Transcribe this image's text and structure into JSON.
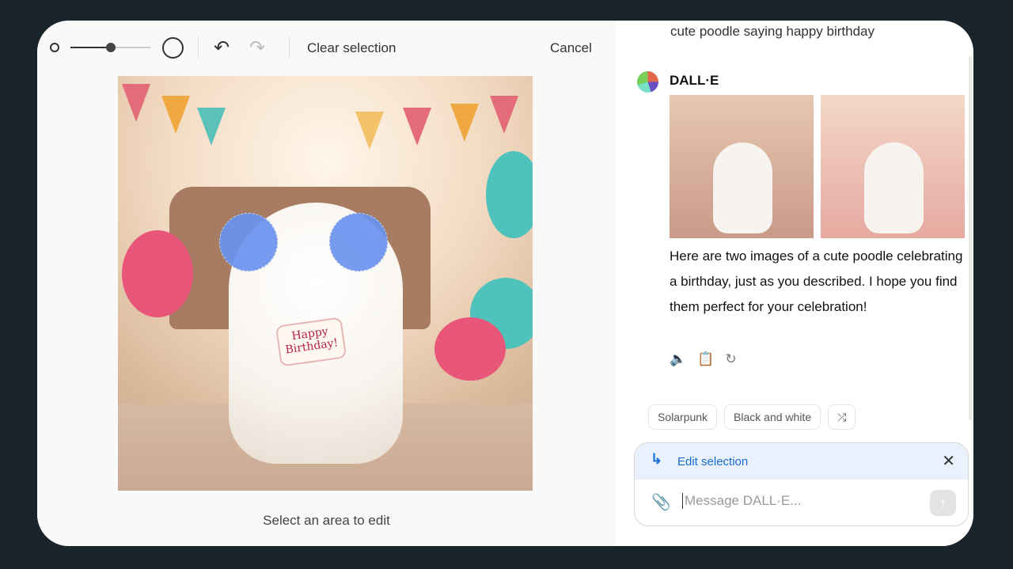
{
  "editor": {
    "brush_size_percent": 50,
    "clear_label": "Clear selection",
    "cancel_label": "Cancel",
    "hint": "Select an area to edit",
    "sign_text": "Happy Birthday!",
    "undo_icon": "undo-icon",
    "redo_icon": "redo-icon"
  },
  "chat": {
    "previous_message": "cute poodle saying happy birthday",
    "sender": "DALL·E",
    "response": "Here are two images of a cute poodle celebrating a birthday, just as you described. I hope you find them perfect for your celebration!",
    "actions": [
      "speaker-icon",
      "clipboard-icon",
      "regenerate-icon"
    ],
    "suggestions": [
      "Solarpunk",
      "Black and white"
    ],
    "composer": {
      "edit_label": "Edit selection",
      "placeholder": "Message DALL·E..."
    }
  },
  "colors": {
    "accent": "#1a6ccc",
    "mask": "#6b93ef",
    "background": "#1a242b"
  }
}
